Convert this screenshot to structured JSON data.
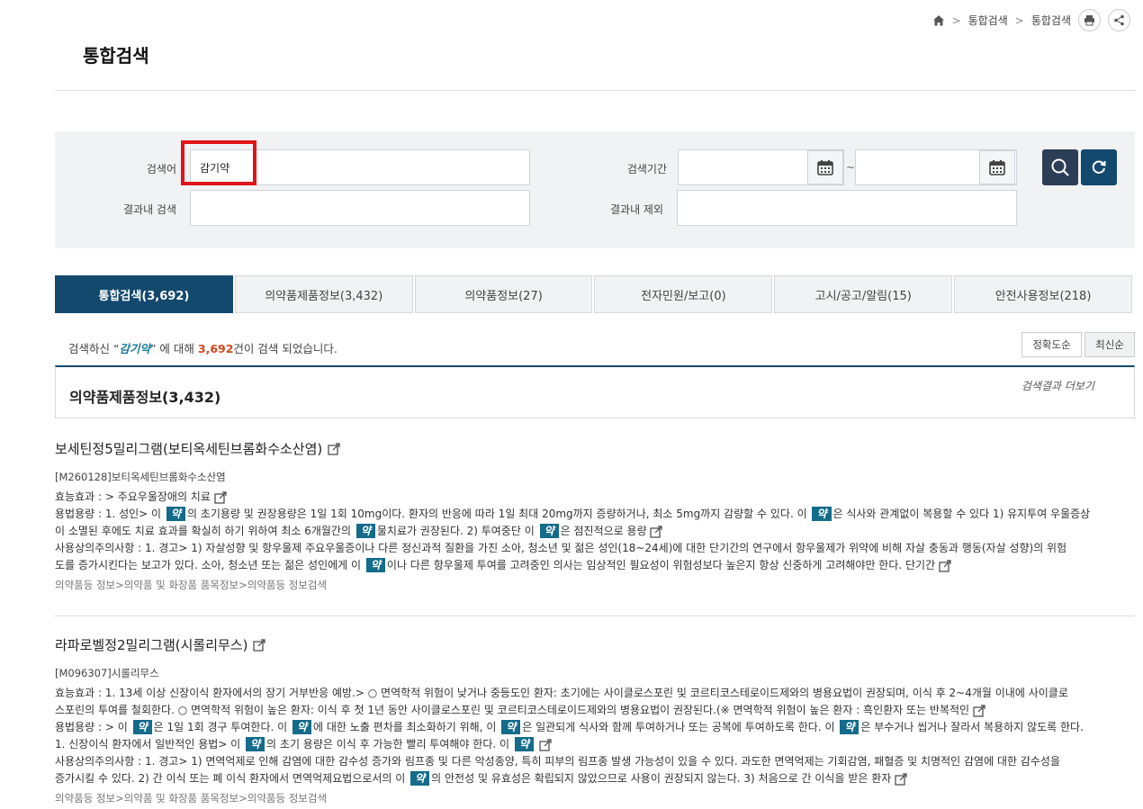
{
  "breadcrumb": {
    "crumb1": "통합검색",
    "crumb2": "통합검색"
  },
  "page": {
    "title": "통합검색"
  },
  "search": {
    "keyword_label": "검색어",
    "keyword_value": "감기약",
    "period_label": "검색기간",
    "period_sep": "~",
    "within_label": "결과내 검색",
    "exclude_label": "결과내 제외"
  },
  "tabs": [
    {
      "label": "통합검색(3,692)"
    },
    {
      "label": "의약품제품정보(3,432)"
    },
    {
      "label": "의약품정보(27)"
    },
    {
      "label": "전자민원/보고(0)"
    },
    {
      "label": "고시/공고/알림(15)"
    },
    {
      "label": "안전사용정보(218)"
    }
  ],
  "summary": {
    "prefix": "검색하신 “",
    "keyword": "감기약",
    "mid": "” 에 대해 ",
    "count": "3,692",
    "suffix": "건이 검색 되었습니다."
  },
  "sort": {
    "accuracy": "정확도순",
    "latest": "최신순"
  },
  "section": {
    "title": "의약품제품정보(3,432)",
    "more": "검색결과 더보기"
  },
  "highlight_word": "약",
  "results": [
    {
      "title": "보세틴정5밀리그램(보티옥세틴브롬화수소산염)",
      "code": "[M260128]보티옥세틴브롬화수소산염",
      "effect": "효능효과 : > 주요우울장애의 치료",
      "dosage_a": "용법용량 : 1. 성인> 이 ",
      "dosage_b": "의 초기용량 및 권장용량은 1일 1회 10mg이다. 환자의 반응에 따라 1일 최대 20mg까지 증량하거나, 최소 5mg까지 감량할 수 있다. 이 ",
      "dosage_c": "은 식사와 관계없이 복용할 수 있다 1) 유지투여 우울증상",
      "dosage_d": "이 소멸된 후에도 치료 효과를 확실히 하기 위하여 최소 6개월간의 ",
      "dosage_e": "물치료가 권장된다. 2) 투여중단 이 ",
      "dosage_f": "은 점진적으로 용량",
      "caution_a": "사용상의주의사항 : 1. 경고> 1) 자살성향 및 항우울제 주요우울증이나 다른 정신과적 질환을 가진 소아, 청소년 및 젊은 성인(18~24세)에 대한 단기간의 연구에서 항우울제가 위약에 비해 자살 충동과 행동(자살 성향)의 위험",
      "caution_b": "도를 증가시킨다는 보고가 있다. 소아, 청소년 또는 젊은 성인에게 이 ",
      "caution_c": "이나 다른 항우울제 투여를 고려중인 의사는 임상적인 필요성이 위험성보다 높은지 항상 신중하게 고려해야만 한다. 단기간",
      "path": "의약품등 정보>의약품 및 화장품 품목정보>의약품등 정보검색"
    },
    {
      "title": "라파로벨정2밀리그램(시롤리무스)",
      "code": "[M096307]시롤리무스",
      "effect_a": "효능효과 : 1. 13세 이상 신장이식 환자에서의 장기 거부반응 예방.> ○ 면역학적 위험이 낮거나 중등도인 환자: 초기에는 사이클로스포린 및 코르티코스테로이드제와의 병용요법이 권장되며, 이식 후 2~4개월 이내에 사이클로",
      "effect_b": "스포린의 투여를 철회한다. ○ 면역학적 위험이 높은 환자: 이식 후 첫 1년 동안 사이클로스포린 및 코르티코스테로이드제와의 병용요법이 권장된다.(※ 면역학적 위험이 높은 환자 : 흑인환자 또는 반복적인",
      "dosage_a": "용법용량 : > 이 ",
      "dosage_b": "은 1일 1회 경구 투여한다. 이 ",
      "dosage_c": "에 대한 노출 편차를 최소화하기 위해, 이 ",
      "dosage_d": "은 일관되게 식사와 함께 투여하거나 또는 공복에 투여하도록 한다. 이 ",
      "dosage_e": "은 부수거나 씹거나 잘라서 복용하지 않도록 한다.",
      "dosage_f": "1. 신장이식 환자에서 일반적인 용법> 이 ",
      "dosage_g": "의 초기 용량은 이식 후 가능한 빨리 투여해야 한다. 이 ",
      "caution_a": "사용상의주의사항 : 1. 경고> 1) 면역억제로 인해 감염에 대한 감수성 증가와 림프종 및 다른 악성종양, 특히 피부의 림프종 발생 가능성이 있을 수 있다. 과도한 면역억제는 기회감염, 패혈증 및 치명적인 감염에 대한 감수성을",
      "caution_b": "증가시킬 수 있다. 2) 간 이식 또는 폐 이식 환자에서 면역억제요법으로서의 이 ",
      "caution_c": "의 안전성 및 유효성은 확립되지 않았으므로 사용이 권장되지 않는다. 3) 처음으로 간 이식을 받은 환자",
      "path": "의약품등 정보>의약품 및 화장품 품목정보>의약품등 정보검색"
    }
  ],
  "colors": {
    "primary": "#14496e",
    "highlight": "#146b8a",
    "count": "#d5471a",
    "marker": "#e0141b"
  }
}
